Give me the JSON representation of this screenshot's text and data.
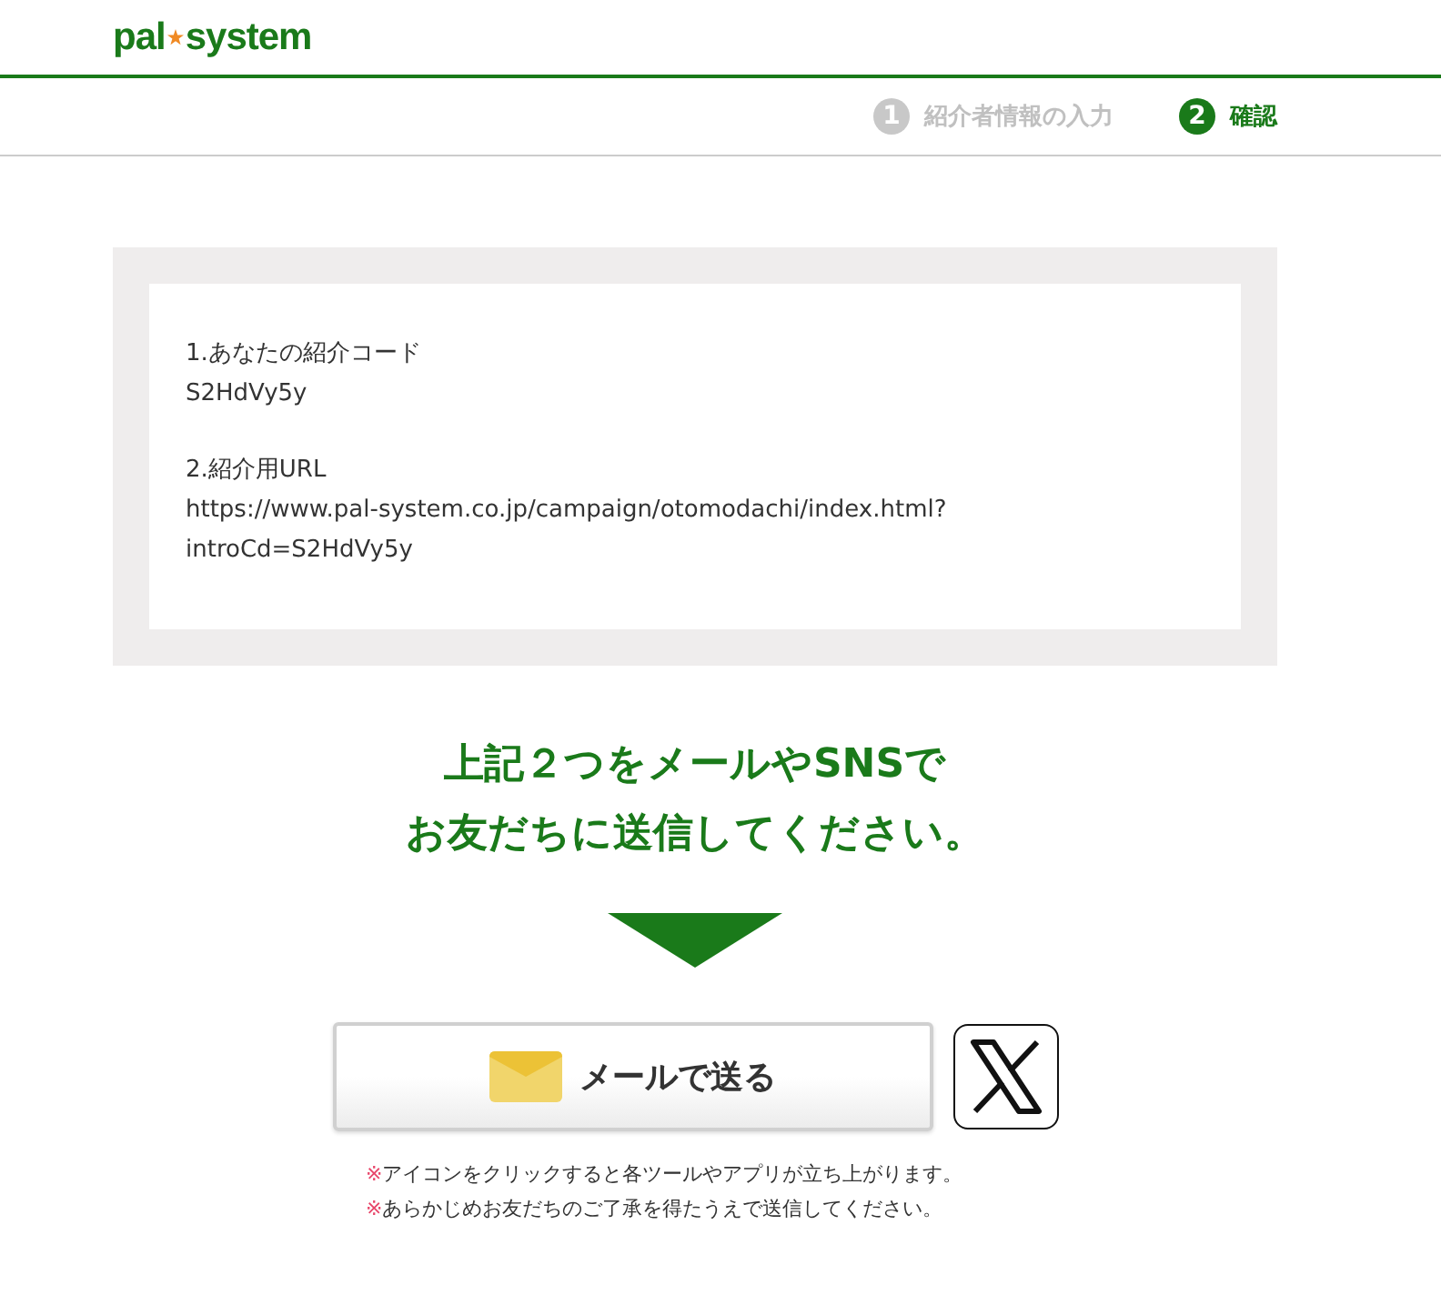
{
  "header": {
    "logo": {
      "left": "pal",
      "right": "system"
    }
  },
  "steps": [
    {
      "number": "1",
      "label": "紹介者情報の入力",
      "selected": false
    },
    {
      "number": "2",
      "label": "確認",
      "selected": true
    }
  ],
  "info": {
    "sections": [
      {
        "heading": "1.あなたの紹介コード",
        "lines": [
          "S2HdVy5y"
        ]
      },
      {
        "heading": "2.紹介用URL",
        "lines": [
          "https://www.pal-system.co.jp/campaign/otomodachi/index.html?",
          "introCd=S2HdVy5y"
        ]
      }
    ]
  },
  "message": [
    "上記２つをメールやSNSで",
    "お友だちに送信してください。"
  ],
  "buttons": {
    "mail": "メールで送る"
  },
  "notes": [
    {
      "mark": "※",
      "text": "アイコンをクリックすると各ツールやアプリが立ち上がります。"
    },
    {
      "mark": "※",
      "text": "あらかじめお友だちのご了承を得たうえで送信してください。"
    }
  ]
}
